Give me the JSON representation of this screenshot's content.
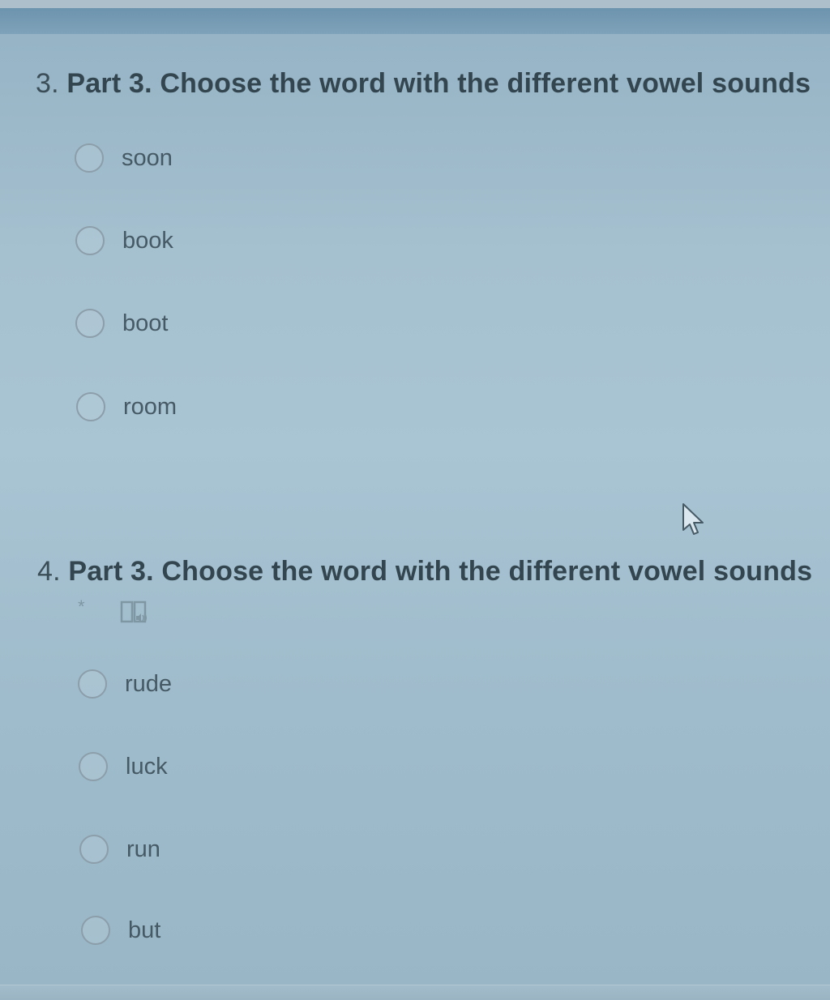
{
  "questions": [
    {
      "number": "3.",
      "title": "Part 3. Choose the word with the different vowel sounds",
      "options": [
        {
          "label": "soon"
        },
        {
          "label": "book"
        },
        {
          "label": "boot"
        },
        {
          "label": "room"
        }
      ]
    },
    {
      "number": "4.",
      "title": "Part 3. Choose the word with the different vowel sounds",
      "required_marker": "*",
      "icons": [
        "immersive-reader-audio-icon"
      ],
      "options": [
        {
          "label": "rude"
        },
        {
          "label": "luck"
        },
        {
          "label": "run"
        },
        {
          "label": "but"
        }
      ]
    }
  ],
  "pointer": {
    "icon": "mouse-cursor-icon"
  },
  "colors": {
    "background": "#a5c0cf",
    "top_bar": "#6d94ae",
    "title_text": "#33464f",
    "option_text": "#465a65",
    "radio_border": "#8b9ea9"
  }
}
